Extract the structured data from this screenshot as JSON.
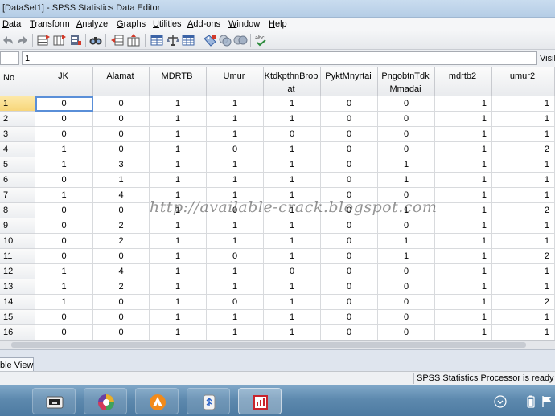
{
  "window": {
    "title": "[DataSet1] - SPSS Statistics Data Editor"
  },
  "menu": [
    "Data",
    "Transform",
    "Analyze",
    "Graphs",
    "Utilities",
    "Add-ons",
    "Window",
    "Help"
  ],
  "toolbar_icons": [
    "undo-icon",
    "redo-icon",
    "goto-case-icon",
    "goto-variable-icon",
    "variables-icon",
    "insert-cases-icon",
    "insert-variable-icon",
    "split-file-icon",
    "weight-cases-icon",
    "select-cases-icon",
    "value-labels-icon",
    "use-sets-icon",
    "show-all-variables-icon",
    "spell-check-icon"
  ],
  "cell_editor": {
    "value": "1",
    "visible_label": "Visib"
  },
  "grid": {
    "row_header_label": "No",
    "columns": [
      "JK",
      "Alamat",
      "MDRTB",
      "Umur",
      "KtdkpthnBrobat",
      "PyktMnyrtai",
      "PngobtnTdkMmadai",
      "mdrtb2",
      "umur2"
    ],
    "rows": [
      {
        "no": "1",
        "values": [
          "0",
          "0",
          "1",
          "1",
          "1",
          "0",
          "0",
          "1",
          "1"
        ]
      },
      {
        "no": "2",
        "values": [
          "0",
          "0",
          "1",
          "1",
          "1",
          "0",
          "0",
          "1",
          "1"
        ]
      },
      {
        "no": "3",
        "values": [
          "0",
          "0",
          "1",
          "1",
          "0",
          "0",
          "0",
          "1",
          "1"
        ]
      },
      {
        "no": "4",
        "values": [
          "1",
          "0",
          "1",
          "0",
          "1",
          "0",
          "0",
          "1",
          "2"
        ]
      },
      {
        "no": "5",
        "values": [
          "1",
          "3",
          "1",
          "1",
          "1",
          "0",
          "1",
          "1",
          "1"
        ]
      },
      {
        "no": "6",
        "values": [
          "0",
          "1",
          "1",
          "1",
          "1",
          "0",
          "1",
          "1",
          "1"
        ]
      },
      {
        "no": "7",
        "values": [
          "1",
          "4",
          "1",
          "1",
          "1",
          "0",
          "0",
          "1",
          "1"
        ]
      },
      {
        "no": "8",
        "values": [
          "0",
          "0",
          "1",
          "0",
          "1",
          "0",
          "1",
          "1",
          "2"
        ]
      },
      {
        "no": "9",
        "values": [
          "0",
          "2",
          "1",
          "1",
          "1",
          "0",
          "0",
          "1",
          "1"
        ]
      },
      {
        "no": "10",
        "values": [
          "0",
          "2",
          "1",
          "1",
          "1",
          "0",
          "1",
          "1",
          "1"
        ]
      },
      {
        "no": "11",
        "values": [
          "0",
          "0",
          "1",
          "0",
          "1",
          "0",
          "1",
          "1",
          "2"
        ]
      },
      {
        "no": "12",
        "values": [
          "1",
          "4",
          "1",
          "1",
          "0",
          "0",
          "0",
          "1",
          "1"
        ]
      },
      {
        "no": "13",
        "values": [
          "1",
          "2",
          "1",
          "1",
          "1",
          "0",
          "0",
          "1",
          "1"
        ]
      },
      {
        "no": "14",
        "values": [
          "1",
          "0",
          "1",
          "0",
          "1",
          "0",
          "0",
          "1",
          "2"
        ]
      },
      {
        "no": "15",
        "values": [
          "0",
          "0",
          "1",
          "1",
          "1",
          "0",
          "0",
          "1",
          "1"
        ]
      },
      {
        "no": "16",
        "values": [
          "0",
          "0",
          "1",
          "1",
          "1",
          "0",
          "0",
          "1",
          "1"
        ]
      }
    ]
  },
  "tab": {
    "label": "ble View"
  },
  "status": {
    "text": "SPSS Statistics  Processor is ready"
  },
  "watermark": "http://available-crack.blogspot.com",
  "taskbar": {
    "buttons": [
      "explorer-icon",
      "media-icon",
      "arrow-app-icon",
      "usb-icon",
      "spss-icon"
    ],
    "tray": [
      "show-desktop-icon",
      "battery-icon",
      "flag-icon"
    ]
  }
}
